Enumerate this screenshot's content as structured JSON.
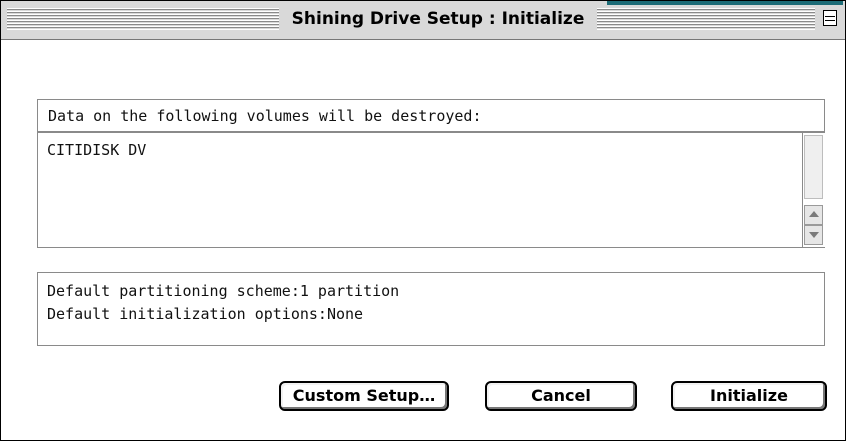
{
  "window": {
    "title": "Shining Drive Setup : Initialize"
  },
  "volumes": {
    "header": "Data on the following volumes will be destroyed:",
    "items": [
      "CITIDISK DV"
    ]
  },
  "defaults": {
    "partitioning": "Default partitioning scheme:1 partition",
    "initialization": "Default initialization options:None"
  },
  "buttons": {
    "custom_setup": "Custom Setup…",
    "cancel": "Cancel",
    "initialize": "Initialize"
  },
  "icons": {
    "collapse": "window-collapse-icon",
    "scroll_up": "arrow-up-icon",
    "scroll_down": "arrow-down-icon"
  },
  "colors": {
    "accent": "#1c6b76"
  }
}
